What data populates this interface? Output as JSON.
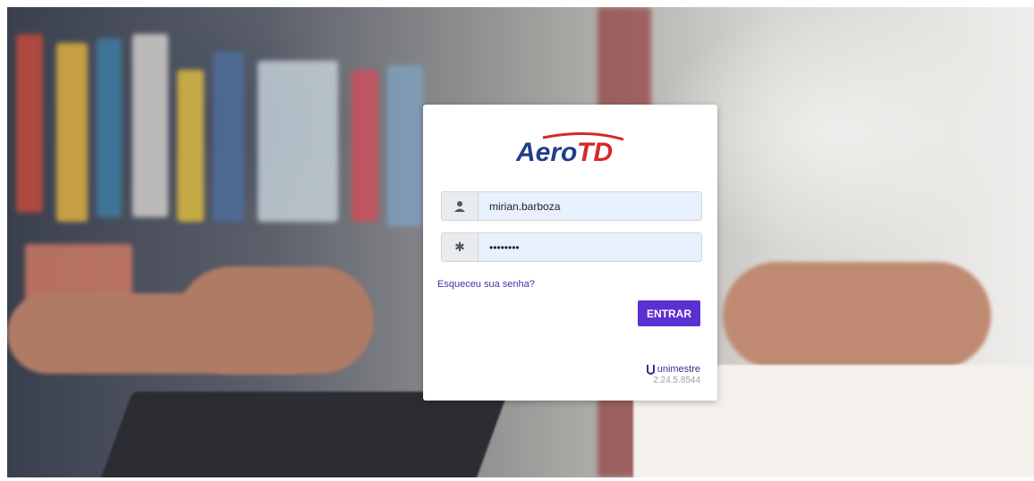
{
  "login": {
    "logo_text": "AeroTD",
    "username_value": "mirian.barboza",
    "password_value": "••••••••",
    "username_icon": "user-icon",
    "password_icon": "asterisk-icon",
    "forgot_link": "Esqueceu sua senha?",
    "submit_label": "ENTRAR"
  },
  "footer": {
    "brand_name": "unimestre",
    "version": "2.24.5.8544"
  },
  "colors": {
    "accent": "#5b30d0",
    "logo_blue": "#1f3d8a",
    "logo_red": "#d42a2a"
  }
}
